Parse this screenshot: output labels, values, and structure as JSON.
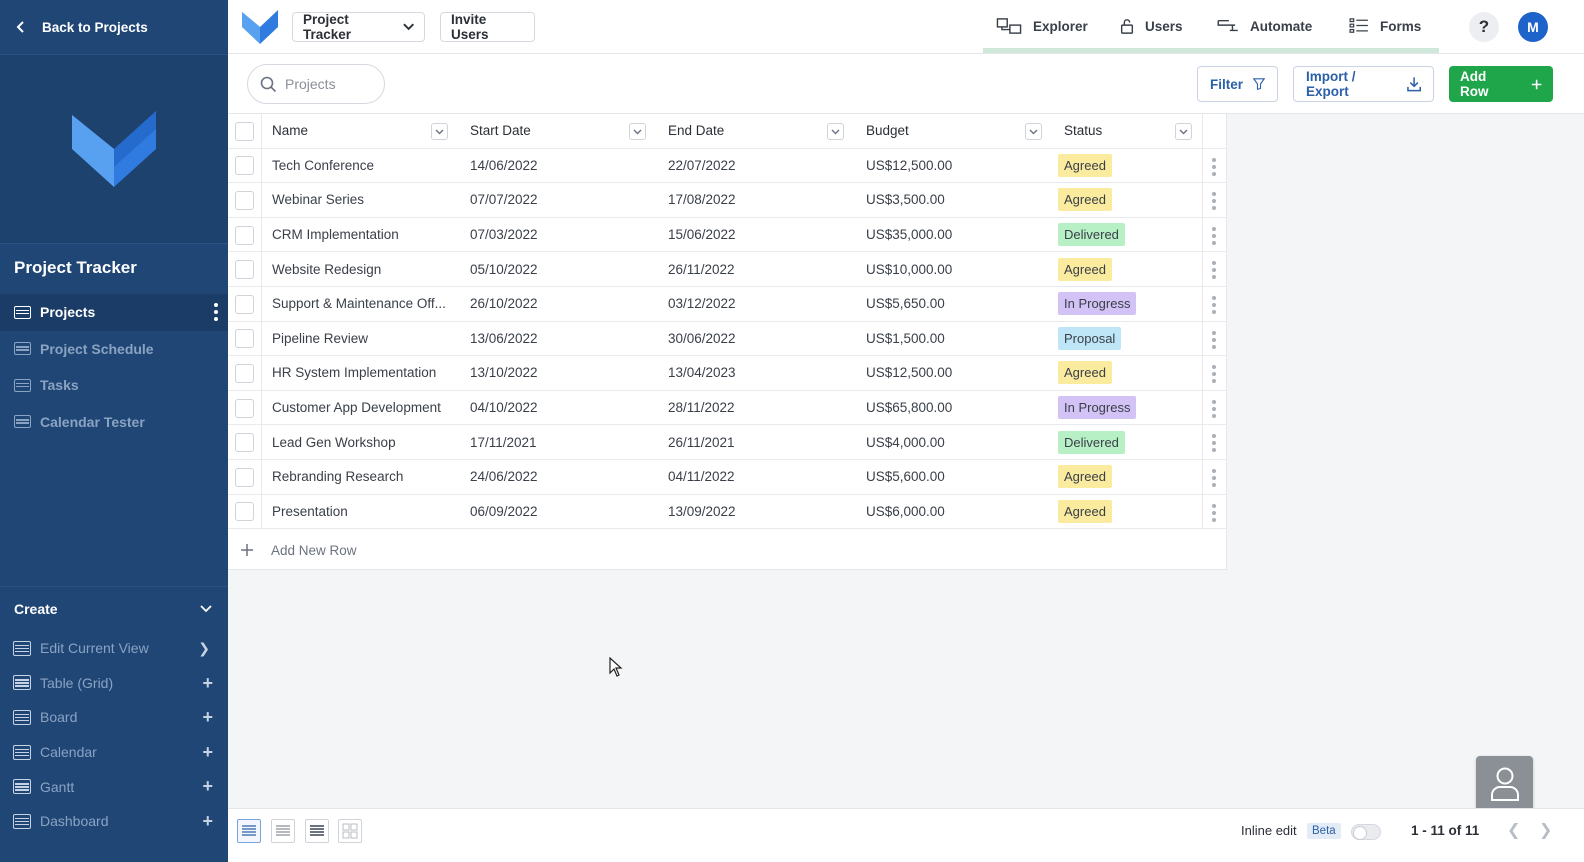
{
  "sidebar": {
    "back_label": "Back to Projects",
    "app_title": "Project Tracker",
    "nav": [
      {
        "label": "Projects",
        "active": true
      },
      {
        "label": "Project Schedule",
        "active": false
      },
      {
        "label": "Tasks",
        "active": false
      },
      {
        "label": "Calendar Tester",
        "active": false
      }
    ],
    "create": {
      "title": "Create",
      "items": [
        {
          "label": "Edit Current View",
          "action": "chevron"
        },
        {
          "label": "Table (Grid)",
          "action": "plus"
        },
        {
          "label": "Board",
          "action": "plus"
        },
        {
          "label": "Calendar",
          "action": "plus"
        },
        {
          "label": "Gantt",
          "action": "plus"
        },
        {
          "label": "Dashboard",
          "action": "plus"
        }
      ]
    }
  },
  "topbar": {
    "project_selector": "Project Tracker",
    "invite_label": "Invite Users",
    "nav": [
      {
        "label": "Explorer",
        "icon": "explorer-icon"
      },
      {
        "label": "Users",
        "icon": "lock-icon"
      },
      {
        "label": "Automate",
        "icon": "automate-icon"
      },
      {
        "label": "Forms",
        "icon": "forms-icon"
      }
    ],
    "help_label": "?",
    "avatar_initial": "M"
  },
  "toolbar": {
    "search_placeholder": "Projects",
    "filter_label": "Filter",
    "import_export_label": "Import / Export",
    "add_row_label": "Add Row"
  },
  "grid": {
    "columns": [
      "Name",
      "Start Date",
      "End Date",
      "Budget",
      "Status"
    ],
    "rows": [
      {
        "name": "Tech Conference",
        "start": "14/06/2022",
        "end": "22/07/2022",
        "budget": "US$12,500.00",
        "status": "Agreed"
      },
      {
        "name": "Webinar Series",
        "start": "07/07/2022",
        "end": "17/08/2022",
        "budget": "US$3,500.00",
        "status": "Agreed"
      },
      {
        "name": "CRM Implementation",
        "start": "07/03/2022",
        "end": "15/06/2022",
        "budget": "US$35,000.00",
        "status": "Delivered"
      },
      {
        "name": "Website Redesign",
        "start": "05/10/2022",
        "end": "26/11/2022",
        "budget": "US$10,000.00",
        "status": "Agreed"
      },
      {
        "name": "Support & Maintenance Off...",
        "start": "26/10/2022",
        "end": "03/12/2022",
        "budget": "US$5,650.00",
        "status": "In Progress"
      },
      {
        "name": "Pipeline Review",
        "start": "13/06/2022",
        "end": "30/06/2022",
        "budget": "US$1,500.00",
        "status": "Proposal"
      },
      {
        "name": "HR System Implementation",
        "start": "13/10/2022",
        "end": "13/04/2023",
        "budget": "US$12,500.00",
        "status": "Agreed"
      },
      {
        "name": "Customer App Development",
        "start": "04/10/2022",
        "end": "28/11/2022",
        "budget": "US$65,800.00",
        "status": "In Progress"
      },
      {
        "name": "Lead Gen Workshop",
        "start": "17/11/2021",
        "end": "26/11/2021",
        "budget": "US$4,000.00",
        "status": "Delivered"
      },
      {
        "name": "Rebranding Research",
        "start": "24/06/2022",
        "end": "04/11/2022",
        "budget": "US$5,600.00",
        "status": "Agreed"
      },
      {
        "name": "Presentation",
        "start": "06/09/2022",
        "end": "13/09/2022",
        "budget": "US$6,000.00",
        "status": "Agreed"
      }
    ],
    "add_row_label": "Add New Row",
    "status_colors": {
      "Agreed": "#fbeb9e",
      "Delivered": "#b8f0c6",
      "In Progress": "#d2c2f5",
      "Proposal": "#bfe6f7"
    }
  },
  "footer": {
    "inline_edit_label": "Inline edit",
    "beta_label": "Beta",
    "pagination": "1 - 11 of 11"
  }
}
